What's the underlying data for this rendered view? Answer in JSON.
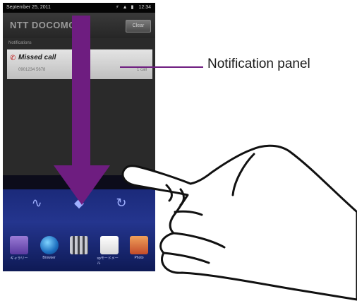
{
  "statusbar": {
    "date": "September 25, 2011",
    "time": "12:34",
    "icons": [
      "usb-icon",
      "signal-icon",
      "battery-icon"
    ]
  },
  "panel": {
    "carrier": "NTT DOCOMO",
    "clear_label": "Clear",
    "section_label": "Notifications",
    "notification": {
      "title": "Missed call",
      "subtitle": "0901234 5678",
      "time": "1 call",
      "icon": "missed-call-icon"
    }
  },
  "homescreen": {
    "widgets": [
      "pulse-icon",
      "location-icon",
      "refresh-icon"
    ],
    "dock": [
      {
        "label": "ギャラリー",
        "icon": "gallery-icon"
      },
      {
        "label": "Browser",
        "icon": "browser-icon"
      },
      {
        "label": "",
        "icon": "app-drawer-icon"
      },
      {
        "label": "spモードメール",
        "icon": "mail-icon"
      },
      {
        "label": "Photo",
        "icon": "photo-icon"
      }
    ]
  },
  "annotation": {
    "callout": "Notification panel",
    "arrow_color": "#6e1d80"
  }
}
